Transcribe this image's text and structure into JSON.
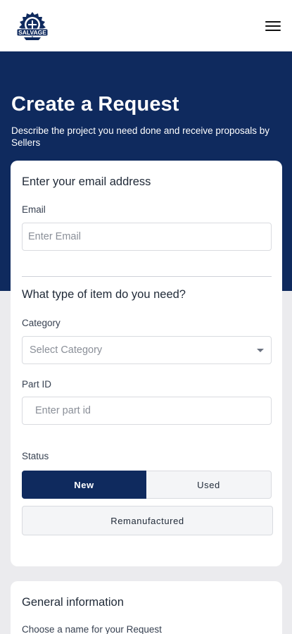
{
  "header": {
    "logo_icon": "salvage-logo-icon",
    "logo_text": "SALVAGE",
    "menu_icon": "hamburger-menu-icon"
  },
  "hero": {
    "title": "Create a Request",
    "subtitle": "Describe the project you need done and receive proposals by Sellers"
  },
  "email_section": {
    "heading": "Enter your email address",
    "email_label": "Email",
    "email_placeholder": "Enter Email",
    "email_value": ""
  },
  "item_section": {
    "heading": "What type of item do you need?",
    "category_label": "Category",
    "category_placeholder": "Select Category",
    "part_id_label": "Part ID",
    "part_id_placeholder": "Enter part id",
    "status_label": "Status",
    "status_options": [
      "New",
      "Used",
      "Remanufactured"
    ],
    "status_selected": "New"
  },
  "general_section": {
    "heading": "General information",
    "name_label": "Choose a name for your Request"
  },
  "colors": {
    "primary_navy": "#0f2a5e",
    "page_background": "#ebebee",
    "card_background": "#ffffff"
  }
}
